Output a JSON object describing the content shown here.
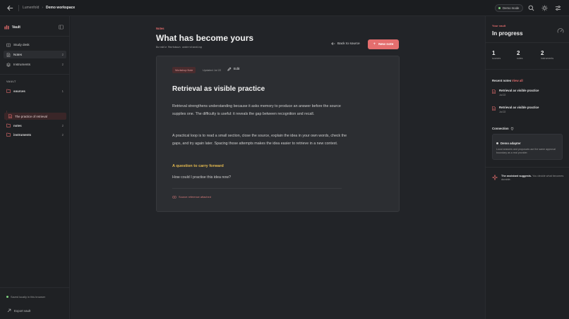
{
  "topbar": {
    "breadcrumb": [
      "Lumenfold",
      "Demo workspace"
    ],
    "demo_mode": "Demo mode",
    "icons": [
      "back-arrow-icon",
      "search-icon",
      "sun-icon",
      "sliders-icon"
    ]
  },
  "sidebar": {
    "brand": "Vault",
    "nav": [
      {
        "label": "Study desk",
        "count": ""
      },
      {
        "label": "Notes",
        "count": "2"
      },
      {
        "label": "Instruments",
        "count": "2"
      }
    ],
    "vault_label": "VAULT",
    "folders": [
      {
        "label": "sources",
        "count": "1"
      },
      {
        "label": "notes",
        "count": "2"
      },
      {
        "label": "instruments",
        "count": "2"
      }
    ],
    "open_file": "The practice of retrieval",
    "saved_status": "Saved locally in this browser",
    "export": "Export vault"
  },
  "main": {
    "eyebrow": "Notes",
    "title": "What has become yours",
    "subtitle": "Durable Markdown understanding",
    "back_link": "Back to source",
    "new_note": "New note",
    "card": {
      "badge": "Workshop Note",
      "updated": "Updated Jul 22",
      "edit": "Edit",
      "title": "Retrieval as visible practice",
      "para1": "Retrieval strengthens understanding because it asks memory to produce an answer before the source supplies one. The difficulty is useful: it reveals the gap between recognition and recall.",
      "para2": "A practical loop is to read a small section, close the source, explain the idea in your own words, check the gaps, and try again later. Spacing those attempts makes the idea easier to retrieve in a new context.",
      "question_heading": "A question to carry forward",
      "question_text": "How could I practise this idea now?",
      "source_ref": "Source reference attached"
    }
  },
  "right_panel": {
    "eyebrow": "Your vault",
    "title": "In progress",
    "stats": [
      {
        "num": "1",
        "label": "sources"
      },
      {
        "num": "2",
        "label": "notes"
      },
      {
        "num": "2",
        "label": "instruments"
      }
    ],
    "recent_heading": "Recent notes",
    "view_all": "View all",
    "recent": [
      {
        "title": "Retrieval as visible practice",
        "date": "Jul 22"
      },
      {
        "title": "Retrieval as visible practice",
        "date": "Jul 22"
      }
    ],
    "connection_heading": "Connection",
    "adapter_name": "Demo adapter",
    "adapter_desc": "Local answers and proposals use the same approval boundary as a real provider.",
    "assistant_bold": "The assistant suggests.",
    "assistant_rest": " You decide what becomes durable."
  },
  "colors": {
    "accent": "#e46e6e",
    "question": "#e3b94f",
    "status_ok": "#7dd07d"
  }
}
